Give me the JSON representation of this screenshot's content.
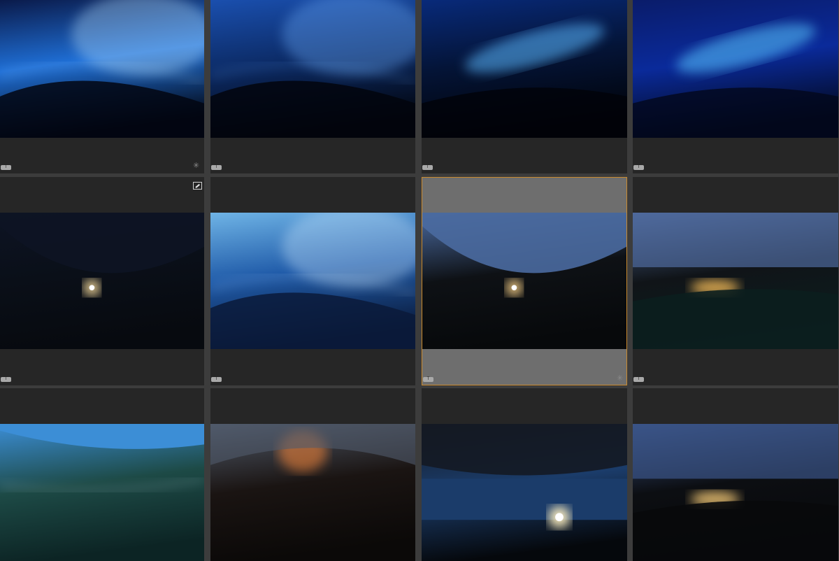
{
  "library": {
    "view": "grid",
    "thumbnails": [
      {
        "badge": "T",
        "icon": "develop-settings-icon",
        "selected": false,
        "scene": {
          "kind": "wave-blue",
          "bg": [
            "#0a1a4a",
            "#1f6fd6",
            "#020612"
          ],
          "glow": "#bfe6ff"
        }
      },
      {
        "badge": "T",
        "icon": "",
        "selected": false,
        "scene": {
          "kind": "wave-blue",
          "bg": [
            "#1a4fae",
            "#0c2b66",
            "#02050d"
          ],
          "glow": "#6fb1ff"
        }
      },
      {
        "badge": "T",
        "icon": "",
        "selected": false,
        "scene": {
          "kind": "wave-streak",
          "bg": [
            "#082a7a",
            "#041437",
            "#010309"
          ],
          "glow": "#5ab8ff"
        }
      },
      {
        "badge": "T",
        "icon": "",
        "selected": false,
        "scene": {
          "kind": "wave-streak",
          "bg": [
            "#0a1c6a",
            "#0a2a9a",
            "#02081c"
          ],
          "glow": "#59c7ff"
        }
      },
      {
        "badge": "T",
        "icon": "crop-edit-icon",
        "selected": false,
        "scene": {
          "kind": "sun-dark",
          "bg": [
            "#0d1424",
            "#0a0f18",
            "#070a0f"
          ],
          "glow": "#ffe2a0"
        }
      },
      {
        "badge": "T",
        "icon": "",
        "selected": false,
        "scene": {
          "kind": "wave-blue",
          "bg": [
            "#6fb4e6",
            "#1f5aa8",
            "#0a1a3a"
          ],
          "glow": "#cfeaff"
        }
      },
      {
        "badge": "T",
        "icon": "develop-settings-icon",
        "selected": true,
        "scene": {
          "kind": "sun-dark",
          "bg": [
            "#4a6aa0",
            "#0e1115",
            "#07090b"
          ],
          "glow": "#ffd68a"
        }
      },
      {
        "badge": "T",
        "icon": "",
        "selected": false,
        "scene": {
          "kind": "sun-splash",
          "bg": [
            "#4f6a9c",
            "#101418",
            "#0b1e1e"
          ],
          "glow": "#ffc25a"
        }
      },
      {
        "badge": "",
        "icon": "",
        "selected": false,
        "scene": {
          "kind": "green-sea",
          "bg": [
            "#3c8ed6",
            "#1d4a46",
            "#0c2424"
          ],
          "glow": "#d8f0ff"
        }
      },
      {
        "badge": "",
        "icon": "",
        "selected": false,
        "scene": {
          "kind": "ember",
          "bg": [
            "#505a6a",
            "#1a1412",
            "#0b0908"
          ],
          "glow": "#ff8a3a"
        }
      },
      {
        "badge": "",
        "icon": "",
        "selected": false,
        "scene": {
          "kind": "sun-horizon",
          "bg": [
            "#141a24",
            "#1b3c6a",
            "#05080c"
          ],
          "glow": "#fff0c0"
        }
      },
      {
        "badge": "",
        "icon": "",
        "selected": false,
        "scene": {
          "kind": "sun-splash",
          "bg": [
            "#3a5488",
            "#0c0e12",
            "#08090b"
          ],
          "glow": "#ffd27a"
        }
      }
    ]
  }
}
